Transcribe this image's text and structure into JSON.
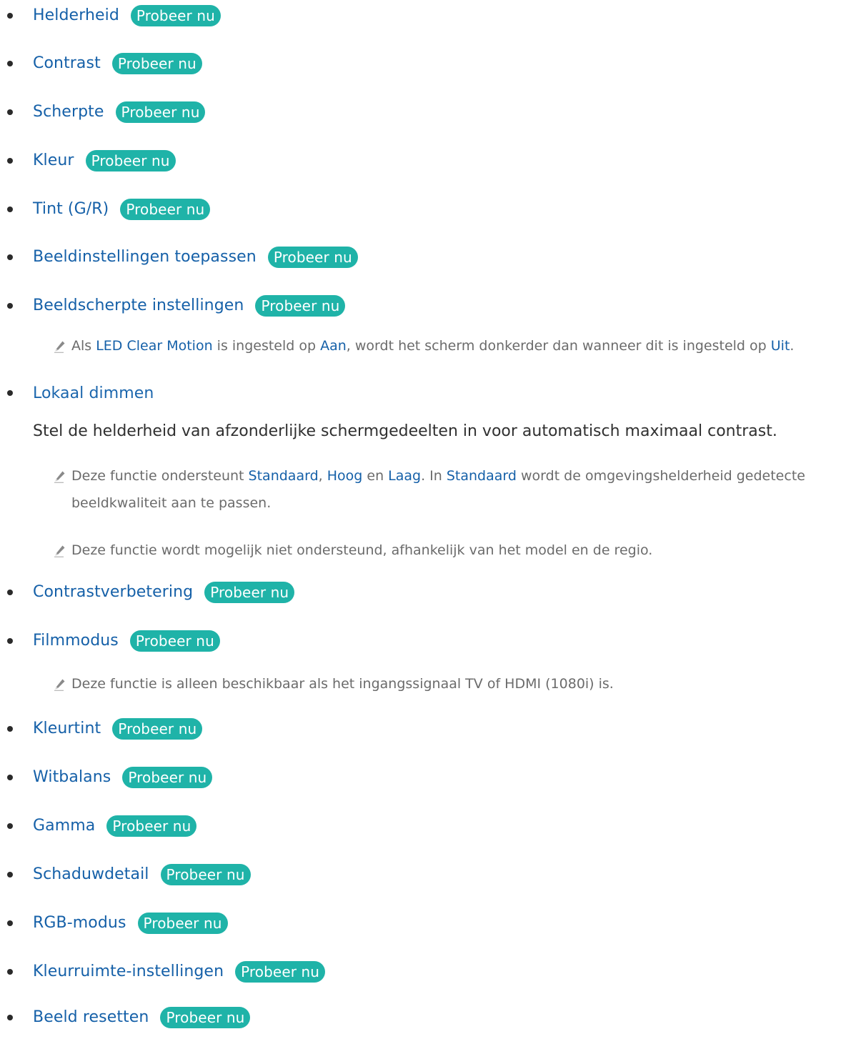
{
  "try_label": "Probeer nu",
  "items": {
    "helderheid": "Helderheid",
    "contrast": "Contrast",
    "scherpte": "Scherpte",
    "kleur": "Kleur",
    "tint": "Tint (G/R)",
    "beeldinstellingen": "Beeldinstellingen toepassen",
    "beeldscherpte": "Beeldscherpte instellingen",
    "lokaal_dimmen": "Lokaal dimmen",
    "contrastverbetering": "Contrastverbetering",
    "filmmodus": "Filmmodus",
    "kleurtint": "Kleurtint",
    "witbalans": "Witbalans",
    "gamma": "Gamma",
    "schaduwdetail": "Schaduwdetail",
    "rgb_modus": "RGB-modus",
    "kleurruimte": "Kleurruimte-instellingen",
    "beeld_resetten": "Beeld resetten"
  },
  "note_led": {
    "p1": "Als ",
    "h1": "LED Clear Motion",
    "p2": " is ingesteld op ",
    "h2": "Aan",
    "p3": ", wordt het scherm donkerder dan wanneer dit is ingesteld op ",
    "h3": "Uit",
    "p4": "."
  },
  "lokaal_desc": "Stel de helderheid van afzonderlijke schermgedeelten in voor automatisch maximaal contrast.",
  "note_support": {
    "p1": "Deze functie ondersteunt ",
    "h1": "Standaard",
    "p2": ", ",
    "h2": "Hoog",
    "p3": " en ",
    "h3": "Laag",
    "p4": ". In ",
    "h4": "Standaard",
    "p5": " wordt de omgevingshelderheid gedetecte",
    "line2": "beeldkwaliteit aan te passen."
  },
  "note_model": "Deze functie wordt mogelijk niet ondersteund, afhankelijk van het model en de regio.",
  "note_film": "Deze functie is alleen beschikbaar als het ingangssignaal TV of HDMI (1080i) is."
}
